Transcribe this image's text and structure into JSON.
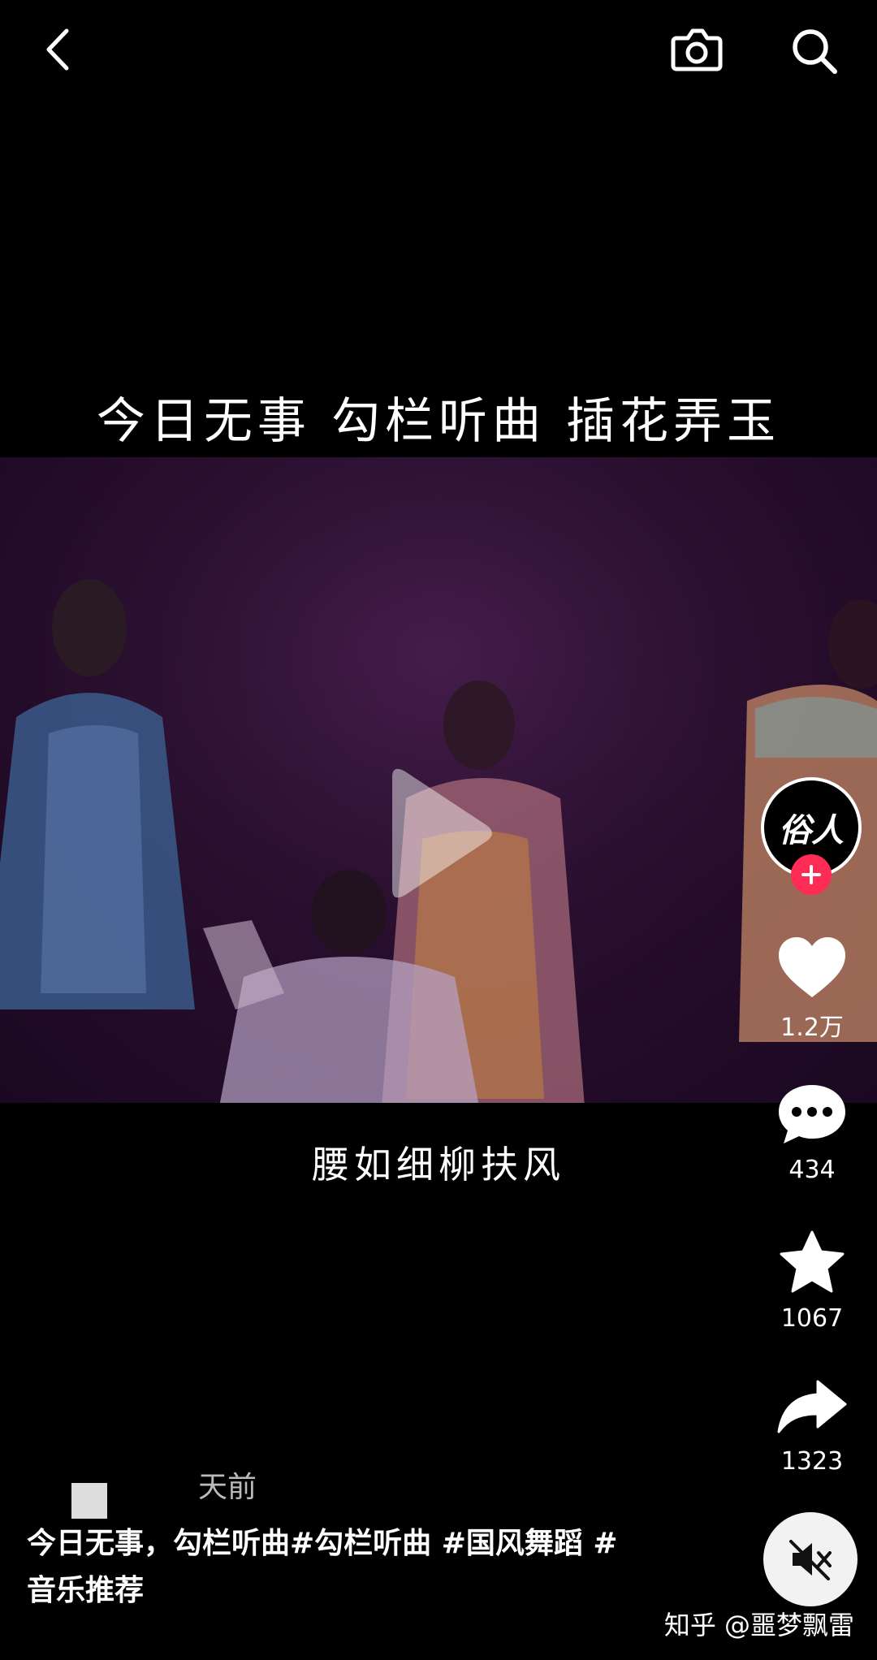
{
  "header": {
    "back_icon": "chevron-left-icon",
    "camera_icon": "camera-icon",
    "search_icon": "search-icon"
  },
  "video": {
    "title_caption": "今日无事 勾栏听曲 插花弄玉",
    "subtitle_caption": "腰如细柳扶风",
    "play_icon": "play-icon"
  },
  "creator": {
    "avatar_text": "俗人",
    "follow_icon": "plus-icon"
  },
  "actions": {
    "like_count": "1.2万",
    "comment_count": "434",
    "favorite_count": "1067",
    "share_count": "1323"
  },
  "post": {
    "time": "天前",
    "description_line1": "今日无事，勾栏听曲#勾栏听曲 #国风舞蹈 #",
    "description_line2": "音乐推荐"
  },
  "mute_icon": "speaker-muted-icon",
  "watermark": "知乎 @噩梦飘雷",
  "colors": {
    "background": "#000000",
    "follow_badge": "#fe2c55",
    "video_tint": "#2a0f30"
  }
}
